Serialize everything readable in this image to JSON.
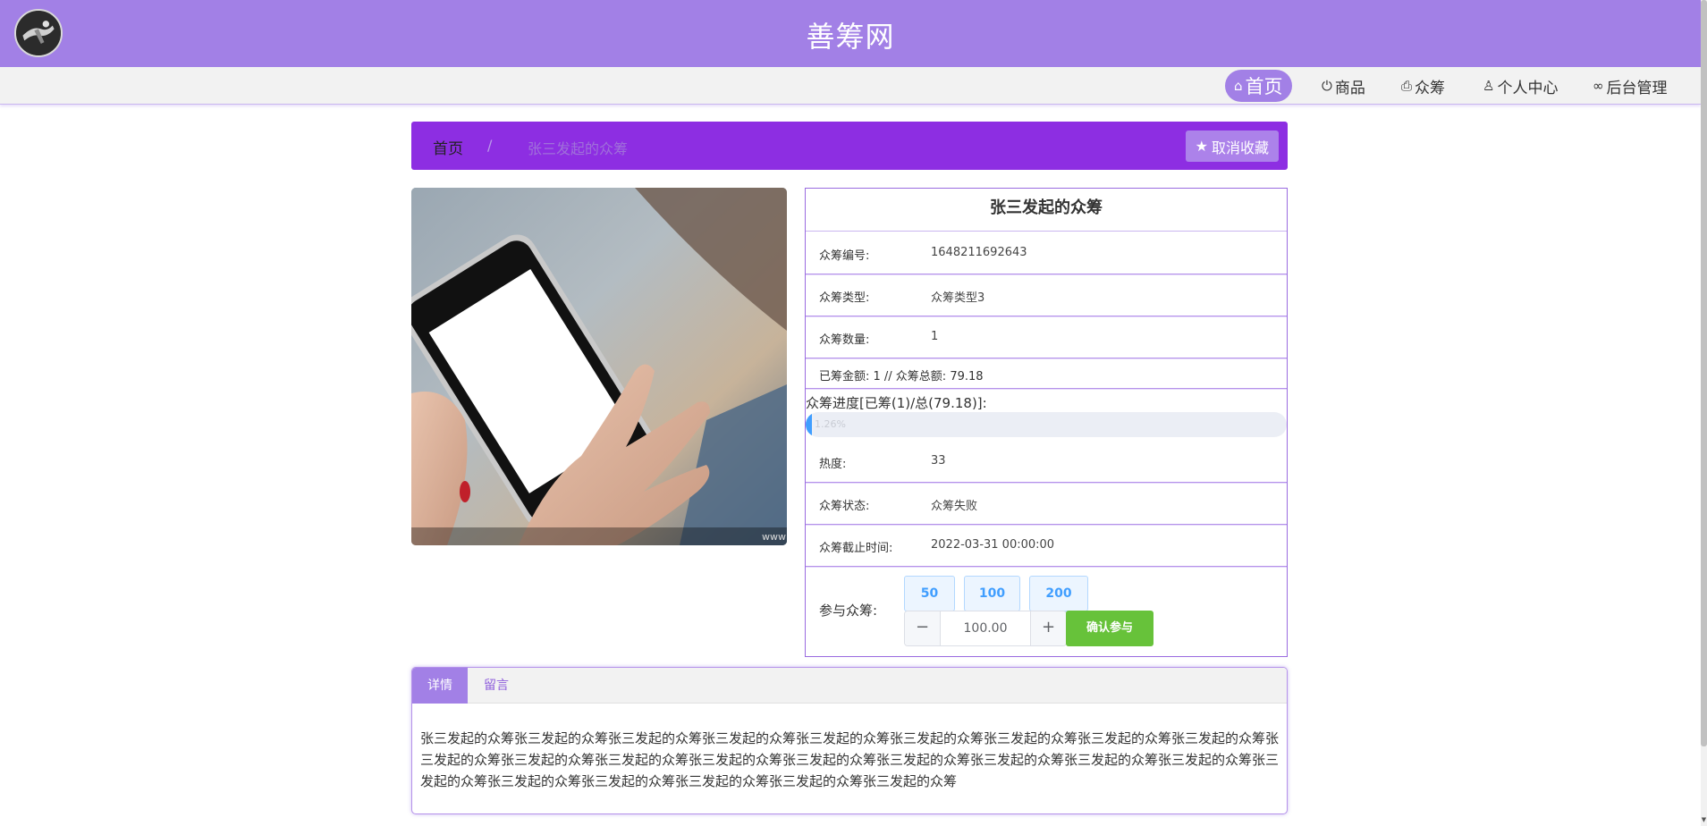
{
  "header": {
    "site_title": "善筹网",
    "logo_icon": "avatar-logo-icon"
  },
  "nav": {
    "items": [
      {
        "icon": "home-icon",
        "label": "首页",
        "active": true
      },
      {
        "icon": "power-icon",
        "label": "商品"
      },
      {
        "icon": "printer-icon",
        "label": "众筹"
      },
      {
        "icon": "user-icon",
        "label": "个人中心"
      },
      {
        "icon": "link-icon",
        "label": "后台管理"
      }
    ]
  },
  "breadcrumb": {
    "home": "首页",
    "separator": "/",
    "current": "张三发起的众筹",
    "fav_button": "取消收藏",
    "fav_icon": "star-icon"
  },
  "detail": {
    "title": "张三发起的众筹",
    "rows": [
      {
        "label": "众筹编号:",
        "value": "1648211692643"
      },
      {
        "label": "众筹类型:",
        "value": "众筹类型3"
      },
      {
        "label": "众筹数量:",
        "value": "1"
      }
    ],
    "amount_line": "已筹金额: 1 // 众筹总额: 79.18",
    "progress": {
      "label": "众筹进度[已筹(1)/总(79.18)]:",
      "percent": 1.26,
      "text": "1.26%"
    },
    "rows2": [
      {
        "label": "热度:",
        "value": "33"
      },
      {
        "label": "众筹状态:",
        "value": "众筹失败"
      },
      {
        "label": "众筹截止时间:",
        "value": "2022-03-31 00:00:00"
      }
    ],
    "join": {
      "label": "参与众筹:",
      "presets": [
        "50",
        "100",
        "200"
      ],
      "amount": "100.00",
      "minus": "−",
      "plus": "+",
      "confirm": "确认参与"
    }
  },
  "tabs": {
    "items": [
      {
        "label": "详情",
        "active": true
      },
      {
        "label": "留言"
      }
    ],
    "content": "张三发起的众筹张三发起的众筹张三发起的众筹张三发起的众筹张三发起的众筹张三发起的众筹张三发起的众筹张三发起的众筹张三发起的众筹张三发起的众筹张三发起的众筹张三发起的众筹张三发起的众筹张三发起的众筹张三发起的众筹张三发起的众筹张三发起的众筹张三发起的众筹张三发起的众筹张三发起的众筹张三发起的众筹张三发起的众筹张三发起的众筹张三发起的众筹"
  },
  "image": {
    "watermark": "www"
  },
  "colors": {
    "brand_purple": "#a280e6",
    "breadcrumb_purple": "#8d2ee2",
    "progress_blue": "#409eff",
    "confirm_green": "#67c23a"
  }
}
